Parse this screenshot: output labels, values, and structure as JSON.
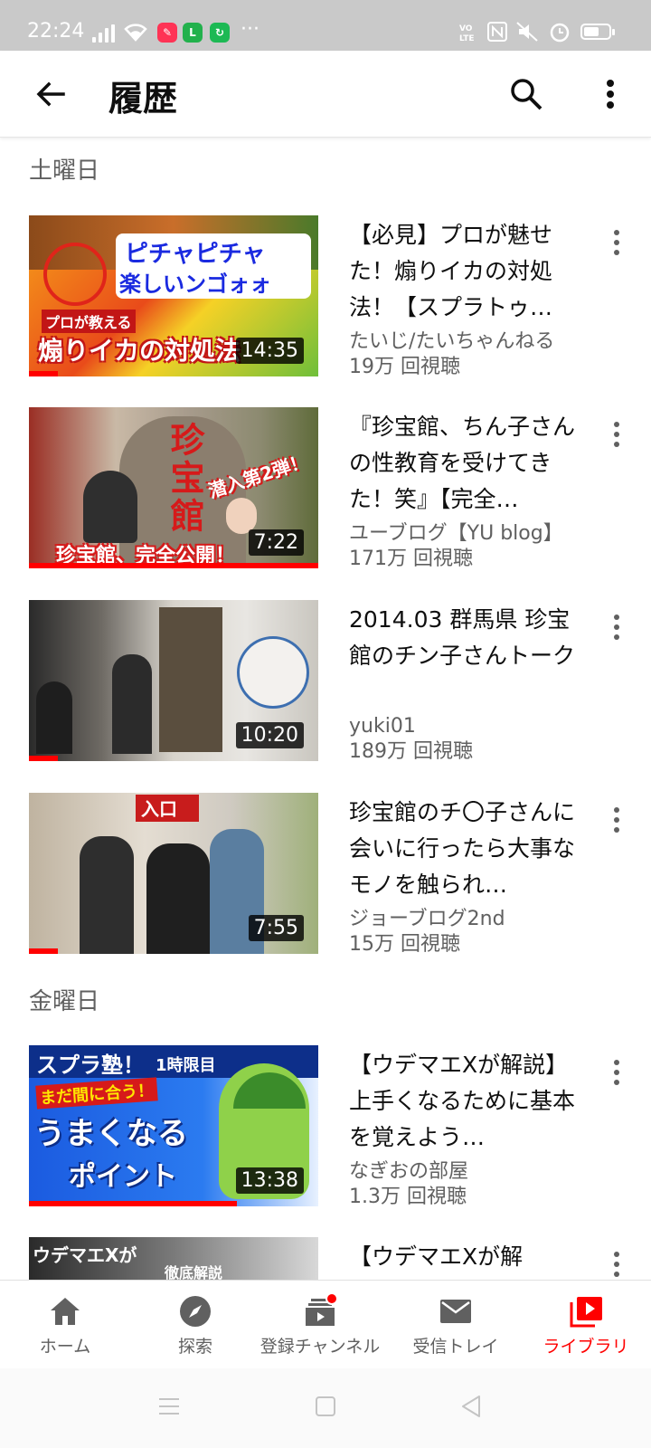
{
  "status": {
    "time": "22:24",
    "more_dots": "···"
  },
  "header": {
    "title": "履歴"
  },
  "sections": [
    {
      "label": "土曜日"
    },
    {
      "label": "金曜日"
    }
  ],
  "videos": [
    {
      "title": "【必見】プロが魅せた！煽りイカの対処法！【スプラトゥ…",
      "channel": "たいじ/たいちゃんねる",
      "views": "19万 回視聴",
      "duration": "14:35",
      "progress": 0.1,
      "thumb_text": [
        "ピチャピチャ",
        "楽しいンゴォォ",
        "プロが教える",
        "煽りイカの対処法"
      ]
    },
    {
      "title": "『珍宝館、ちん子さんの性教育を受けてきた！笑』【完全…",
      "channel": "ユーブログ【YU blog】",
      "views": "171万 回視聴",
      "duration": "7:22",
      "progress": 1.0,
      "thumb_text": [
        "珍宝館",
        "潜入第2弾！",
        "珍宝館、完全公開！"
      ]
    },
    {
      "title": "2014.03 群馬県 珍宝館のチン子さんトーク",
      "channel": "yuki01",
      "views": "189万 回視聴",
      "duration": "10:20",
      "progress": 0.1,
      "thumb_text": []
    },
    {
      "title": "珍宝館のチ〇子さんに会いに行ったら大事なモノを触られ…",
      "channel": "ジョーブログ2nd",
      "views": "15万 回視聴",
      "duration": "7:55",
      "progress": 0.1,
      "thumb_text": [
        "入口"
      ]
    },
    {
      "title": "【ウデマエXが解説】上手くなるために基本を覚えよう…",
      "channel": "なぎおの部屋",
      "views": "1.3万 回視聴",
      "duration": "13:38",
      "progress": 0.72,
      "thumb_text": [
        "スプラ塾！",
        "1時限目",
        "まだ間に合う！",
        "うまくなる",
        "ポイント"
      ]
    },
    {
      "title": "【ウデマエXが解",
      "thumb_text": [
        "ウデマエXが",
        "徹底解説"
      ]
    }
  ],
  "nav": [
    {
      "label": "ホーム",
      "icon": "home-icon"
    },
    {
      "label": "探索",
      "icon": "explore-icon"
    },
    {
      "label": "登録チャンネル",
      "icon": "subscriptions-icon"
    },
    {
      "label": "受信トレイ",
      "icon": "inbox-icon"
    },
    {
      "label": "ライブラリ",
      "icon": "library-icon"
    }
  ],
  "colors": {
    "accent": "#ff0000",
    "secondary_text": "#606060"
  }
}
